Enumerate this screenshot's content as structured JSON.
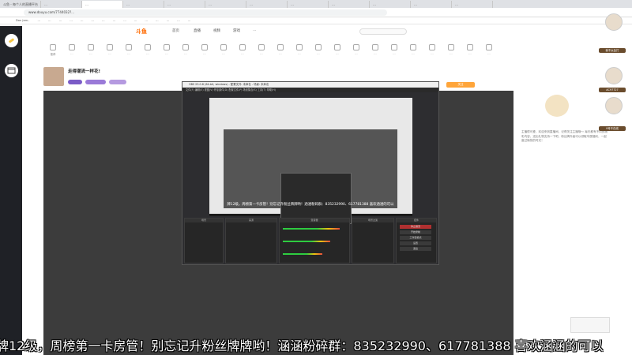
{
  "browser": {
    "tabs": [
      "斗鱼 - 每个人的直播平台",
      "…",
      "…",
      "…",
      "…",
      "…",
      "…",
      "…",
      "…",
      "…",
      "…",
      "…"
    ],
    "url": "www.douyu.com/7744032?...",
    "bookmarks": [
      "Dan Jam..",
      "…",
      "…",
      "…",
      "…",
      "…",
      "…",
      "…",
      "…",
      "…",
      "…",
      "…",
      "…",
      "…",
      "…",
      "…"
    ]
  },
  "site": {
    "logo": "斗鱼",
    "nav": [
      "首页",
      "直播",
      "视频",
      "游戏",
      "…"
    ],
    "categories": [
      "推荐",
      "…",
      "…",
      "…",
      "…",
      "…",
      "…",
      "…",
      "…",
      "…",
      "…",
      "…",
      "…",
      "…",
      "…",
      "…",
      "…",
      "…",
      "…",
      "…",
      "…",
      "…",
      "…",
      "…"
    ]
  },
  "streamer": {
    "room_title": "走得潮流一样花!",
    "follow_label": "关注"
  },
  "obs": {
    "window_title": "OBS 25.0.8 (64-bit, windows) - 配置文件: 未命名 - 场景: 未命名",
    "menu": "文件(F)  编辑(E)  视图(V)  停靠部件(D)  配置文件(P)  场景集合(S)  工具(T)  帮助(H)",
    "overlay_text": "牌12级，周榜第一卡房管！别忘记升粉丝牌牌哟！涵涵粉碎群：835232990、617781388 喜欢涵涵的可以",
    "docks": [
      "场景",
      "来源",
      "混音器",
      "场景过渡",
      "控件"
    ],
    "controls": [
      "停止推流",
      "开始录制",
      "工作室模式",
      "设置",
      "退出"
    ]
  },
  "chat": {
    "text": "主播很可爱，欢迎来到直播间，记得关注主播哦～ 每天都有不同的精彩内容，送出礼物支持一下吧，粉丝牌升级可以领取专属福利，一起度过愉快的时光！"
  },
  "viewers": {
    "badges": [
      "我不太会打",
      "AC97727",
      "9号不在线"
    ]
  },
  "ticker": {
    "text": "牌12级，周榜第一卡房管！别忘记升粉丝牌牌哟！涵涵粉碎群：835232990、617781388 喜欢涵涵的可以"
  },
  "colors": {
    "brand": "#ff6a00",
    "rail": "#1f2126",
    "player_bg": "#3c3c3c",
    "obs_bg": "#2d2d30"
  }
}
